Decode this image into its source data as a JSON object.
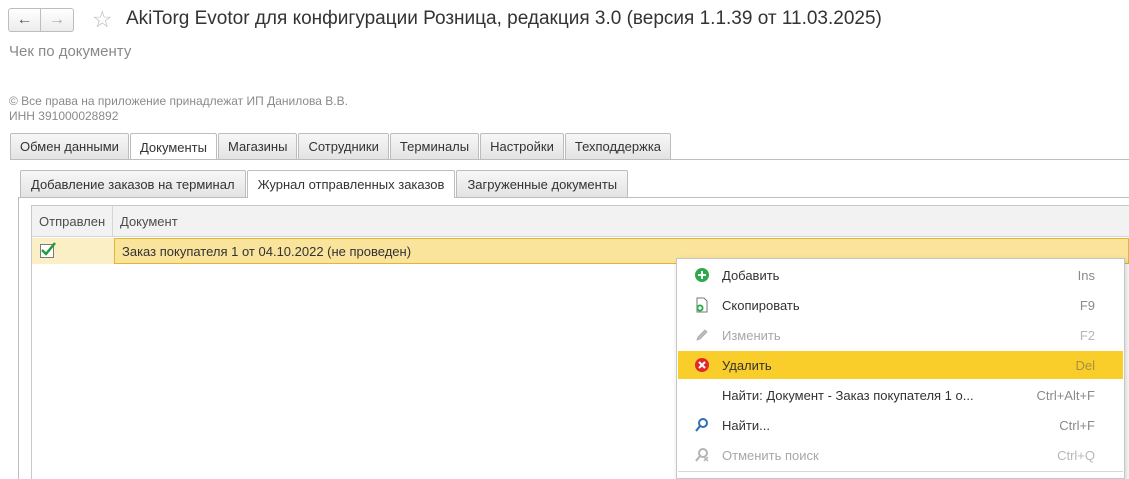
{
  "header": {
    "back_label": "←",
    "forward_label": "→",
    "title": "AkiTorg Evotor для конфигурации Розница, редакция 3.0 (версия 1.1.39 от 11.03.2025)",
    "subtitle": "Чек по документу",
    "copyright": "© Все права на приложение принадлежат ИП Данилова В.В.",
    "inn": "ИНН 391000028892"
  },
  "main_tabs": [
    {
      "label": "Обмен данными"
    },
    {
      "label": "Документы",
      "active": true
    },
    {
      "label": "Магазины"
    },
    {
      "label": "Сотрудники"
    },
    {
      "label": "Терминалы"
    },
    {
      "label": "Настройки"
    },
    {
      "label": "Техподдержка"
    }
  ],
  "sub_tabs": [
    {
      "label": "Добавление заказов на терминал"
    },
    {
      "label": "Журнал отправленных заказов",
      "active": true
    },
    {
      "label": "Загруженные документы"
    }
  ],
  "table": {
    "columns": [
      "Отправлен",
      "Документ"
    ],
    "rows": [
      {
        "sent": true,
        "document": "Заказ покупателя 1 от 04.10.2022 (не проведен)"
      }
    ]
  },
  "context_menu": {
    "items": [
      {
        "label": "Добавить",
        "shortcut": "Ins",
        "icon": "add-circle-icon"
      },
      {
        "label": "Скопировать",
        "shortcut": "F9",
        "icon": "copy-icon"
      },
      {
        "label": "Изменить",
        "shortcut": "F2",
        "icon": "pencil-icon",
        "disabled": true
      },
      {
        "label": "Удалить",
        "shortcut": "Del",
        "icon": "delete-circle-icon",
        "highlighted": true
      },
      {
        "label": "Найти: Документ - Заказ покупателя 1 о...",
        "shortcut": "Ctrl+Alt+F",
        "icon": ""
      },
      {
        "label": "Найти...",
        "shortcut": "Ctrl+F",
        "icon": "search-icon"
      },
      {
        "label": "Отменить поиск",
        "shortcut": "Ctrl+Q",
        "icon": "cancel-search-icon",
        "disabled": true
      }
    ]
  },
  "colors": {
    "row_highlight": "#fae39a",
    "menu_highlight": "#f9ce2a",
    "add_icon": "#2eaa4a",
    "delete_icon": "#e02a2a"
  }
}
